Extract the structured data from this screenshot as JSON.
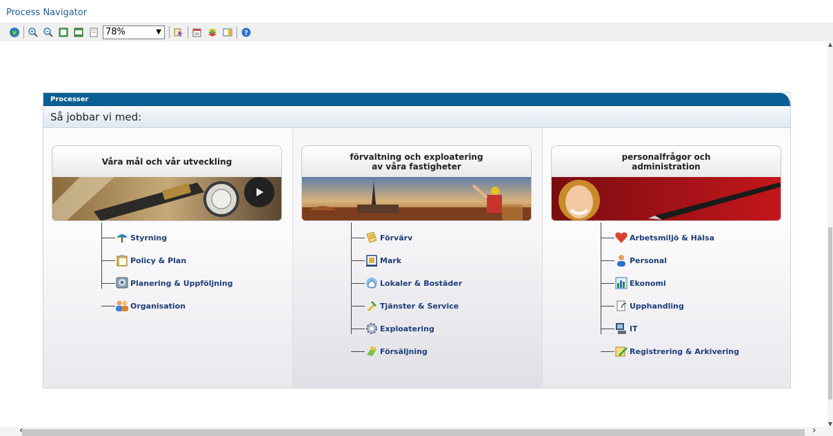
{
  "app": {
    "title": "Process Navigator"
  },
  "toolbar": {
    "zoom": "78%"
  },
  "panel": {
    "header": "Processer",
    "subtitle": "Så jobbar vi med:",
    "columns": [
      {
        "title": "Våra mål och vår utveckling",
        "items": [
          {
            "label": "Styrning",
            "icon": "umbrella-icon"
          },
          {
            "label": "Policy & Plan",
            "icon": "clipboard-icon"
          },
          {
            "label": "Planering & Uppföljning",
            "icon": "monitor-icon"
          },
          {
            "label": "Organisation",
            "icon": "people-icon"
          }
        ]
      },
      {
        "title": "förvaltning och exploatering\nav våra fastigheter",
        "items": [
          {
            "label": "Förvärv",
            "icon": "document-icon"
          },
          {
            "label": "Mark",
            "icon": "map-icon"
          },
          {
            "label": "Lokaler & Bostäder",
            "icon": "house-icon"
          },
          {
            "label": "Tjänster & Service",
            "icon": "tools-icon"
          },
          {
            "label": "Exploatering",
            "icon": "gear-icon"
          },
          {
            "label": "Försäljning",
            "icon": "sale-icon"
          }
        ]
      },
      {
        "title": "personalfrågor och\nadministration",
        "items": [
          {
            "label": "Arbetsmiljö & Hälsa",
            "icon": "heart-icon"
          },
          {
            "label": "Personal",
            "icon": "person-icon"
          },
          {
            "label": "Ekonomi",
            "icon": "bar-chart-icon"
          },
          {
            "label": "Upphandling",
            "icon": "contract-icon"
          },
          {
            "label": "IT",
            "icon": "computer-icon"
          },
          {
            "label": "Registrering & Arkivering",
            "icon": "pencil-icon"
          }
        ]
      }
    ]
  }
}
